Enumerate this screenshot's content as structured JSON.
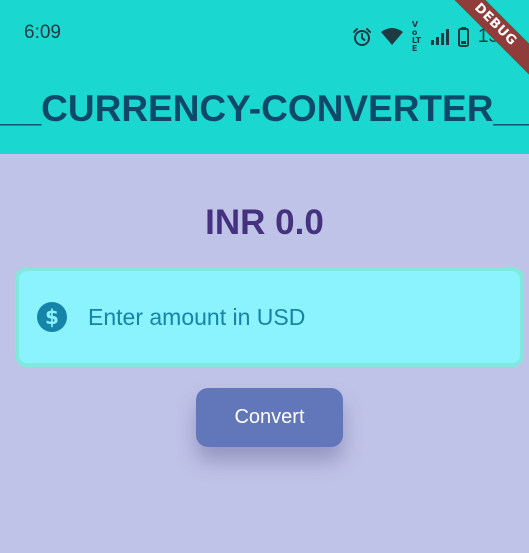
{
  "status_bar": {
    "time": "6:09",
    "network_label": "Vo LTE",
    "battery_percent": "15",
    "icons": [
      "alarm-icon",
      "wifi-icon",
      "volte-icon",
      "signal-icon",
      "battery-icon"
    ]
  },
  "debug_banner": "DEBUG",
  "app_bar": {
    "title": "__CURRENCY-CONVERTER__",
    "background_color": "#1ad8d0"
  },
  "result": {
    "text": "INR 0.0"
  },
  "amount_input": {
    "placeholder": "Enter amount in USD",
    "value": "",
    "icon": "dollar-icon"
  },
  "convert_button": {
    "label": "Convert",
    "color": "#6277b9"
  },
  "colors": {
    "page_background": "#c0c3e8",
    "input_background": "#8af3fd",
    "result_text": "#44327e"
  }
}
